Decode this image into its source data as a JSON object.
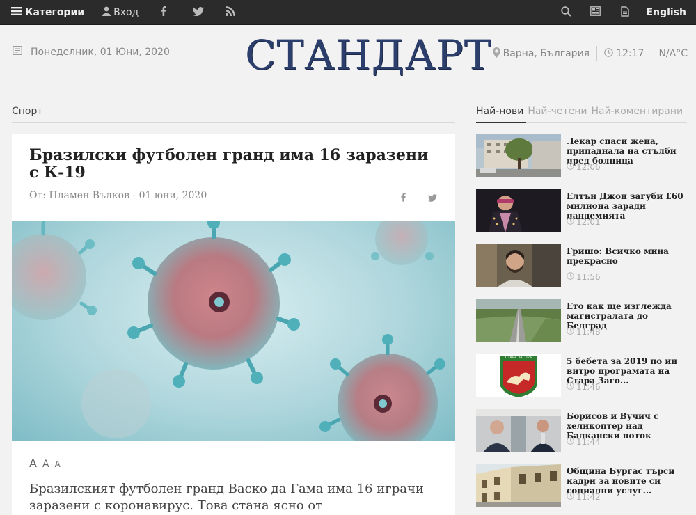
{
  "topbar": {
    "categories_label": "Категории",
    "login_label": "Вход",
    "language_label": "English"
  },
  "header": {
    "date": "Понеделник, 01 Юни, 2020",
    "logo": "СТАНДАРТ",
    "location": "Варна, България",
    "time": "12:17",
    "temperature": "N/A°C"
  },
  "section": {
    "label": "Спорт"
  },
  "article": {
    "title": "Бразилски футболен гранд има 16 заразени с К-19",
    "byline": "От: Пламен Вълков - 01 юни, 2020",
    "font_sizes": [
      "A",
      "A",
      "A"
    ],
    "body": "Бразилският футболен гранд Васко да Гама има 16 играчи заразени с коронавирус. Това стана ясно от"
  },
  "sidebar": {
    "tabs": [
      "Най-нови",
      "Най-четени",
      "Най-коментирани"
    ],
    "items": [
      {
        "title": "Лекар спаси жена, припаднала на стълби пред болница",
        "time": "12:06"
      },
      {
        "title": "Елтън Джон загуби £60 милиона заради пандемията",
        "time": "12:01"
      },
      {
        "title": "Гришо: Всичко мина прекрасно",
        "time": "11:56"
      },
      {
        "title": "Ето как ще изглежда магистралата до Белград",
        "time": "11:48"
      },
      {
        "title": "5 бебета за 2019 по ин витро програмата на Стара Заго...",
        "time": "11:46",
        "crest_text": "СТАРА ЗАГОРА"
      },
      {
        "title": "Борисов и Вучич с хеликоптер над Балкански поток",
        "time": "11:44"
      },
      {
        "title": "Община Бургас търси кадри за новите си социални услуг...",
        "time": "11:42"
      }
    ]
  },
  "colors": {
    "topbar": "#2b2b2b",
    "logo": "#2c3e6b",
    "accent_red": "#c62828",
    "crest_green": "#2e7d32"
  }
}
